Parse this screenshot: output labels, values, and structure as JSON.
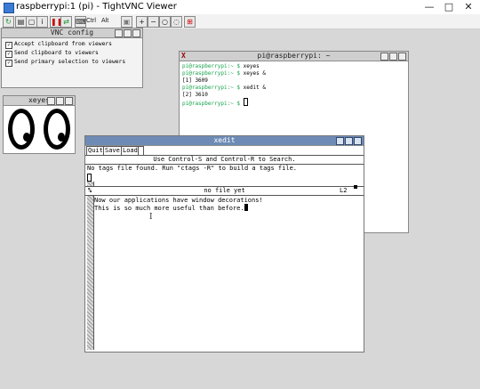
{
  "app": {
    "title": "raspberrypi:1 (pi) - TightVNC Viewer",
    "window_controls": [
      "—",
      "□",
      "✕"
    ]
  },
  "toolbar": {
    "ctrl_label": "Ctrl",
    "alt_label": "Alt",
    "icons": [
      "new-connection-icon",
      "save-icon",
      "options-icon",
      "info-icon",
      "pause-icon",
      "refresh-icon",
      "send-keys-icon",
      "clipboard-icon",
      "zoom-in-icon",
      "zoom-out-icon",
      "zoom-normal-icon",
      "fullscreen-icon",
      "fit-window-icon"
    ]
  },
  "vnc_config": {
    "title": "VNC config",
    "options": [
      {
        "label": "Accept clipboard from viewers",
        "checked": true
      },
      {
        "label": "Send clipboard to viewers",
        "checked": true
      },
      {
        "label": "Send primary selection to viewers",
        "checked": true
      }
    ]
  },
  "xeyes": {
    "title": "xeyes"
  },
  "xterm": {
    "title": "pi@raspberrypi: ~",
    "lines": [
      {
        "prompt": "pi@raspberrypi:~ $",
        "text": " xeyes"
      },
      {
        "prompt": "pi@raspberrypi:~ $",
        "text": " xeyes &"
      },
      {
        "prompt": "",
        "text": "[1] 3609"
      },
      {
        "prompt": "pi@raspberrypi:~ $",
        "text": " xedit &"
      },
      {
        "prompt": "",
        "text": "[2] 3610"
      },
      {
        "prompt": "pi@raspberrypi:~ $",
        "text": " "
      }
    ]
  },
  "xedit": {
    "title": "xedit",
    "buttons": [
      "Quit",
      "Save",
      "Load"
    ],
    "hint": "Use Control-S and Control-R to Search.",
    "message": "No tags file found. Run \"ctags -R\" to build a tags file.",
    "file_status": "no file yet",
    "line_indicator": "L2",
    "mode_mark": "%",
    "body_lines": [
      "Now our applications have window decorations!",
      "This is so much more useful than before."
    ]
  }
}
